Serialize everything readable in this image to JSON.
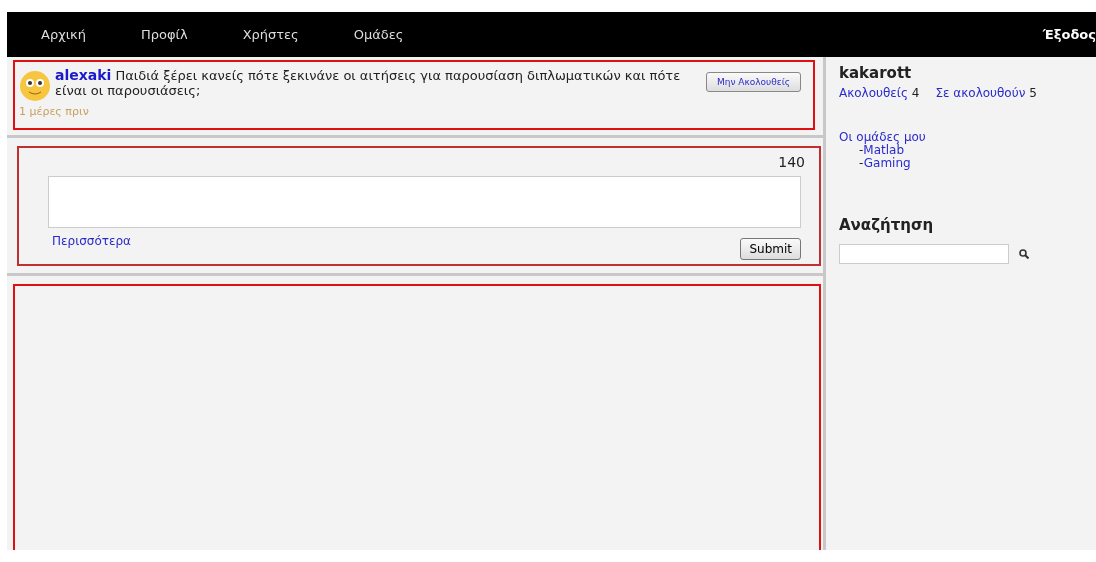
{
  "nav": {
    "items": [
      {
        "label": "Αρχική"
      },
      {
        "label": "Προφίλ"
      },
      {
        "label": "Χρήστες"
      },
      {
        "label": "Ομάδες"
      }
    ],
    "logout": "Έξοδος"
  },
  "post": {
    "author": "alexaki",
    "text": "Παιδιά ξέρει κανείς πότε ξεκινάνε οι αιτήσεις για παρουσίαση διπλωματικών και πότε είναι οι παρουσιάσεις;",
    "time": "1 μέρες πριν",
    "button": "Μην Ακολουθείς"
  },
  "compose": {
    "counter": "140",
    "more": "Περισσότερα",
    "submit": "Submit"
  },
  "sidebar": {
    "username": "kakarott",
    "following_label": "Ακολουθείς",
    "following_count": "4",
    "followers_label": "Σε ακολουθούν",
    "followers_count": "5",
    "groups_title": "Οι ομάδες μου",
    "groups": [
      {
        "prefix": "-",
        "name": "Matlab"
      },
      {
        "prefix": "-",
        "name": "Gaming"
      }
    ],
    "search_title": "Αναζήτηση"
  }
}
